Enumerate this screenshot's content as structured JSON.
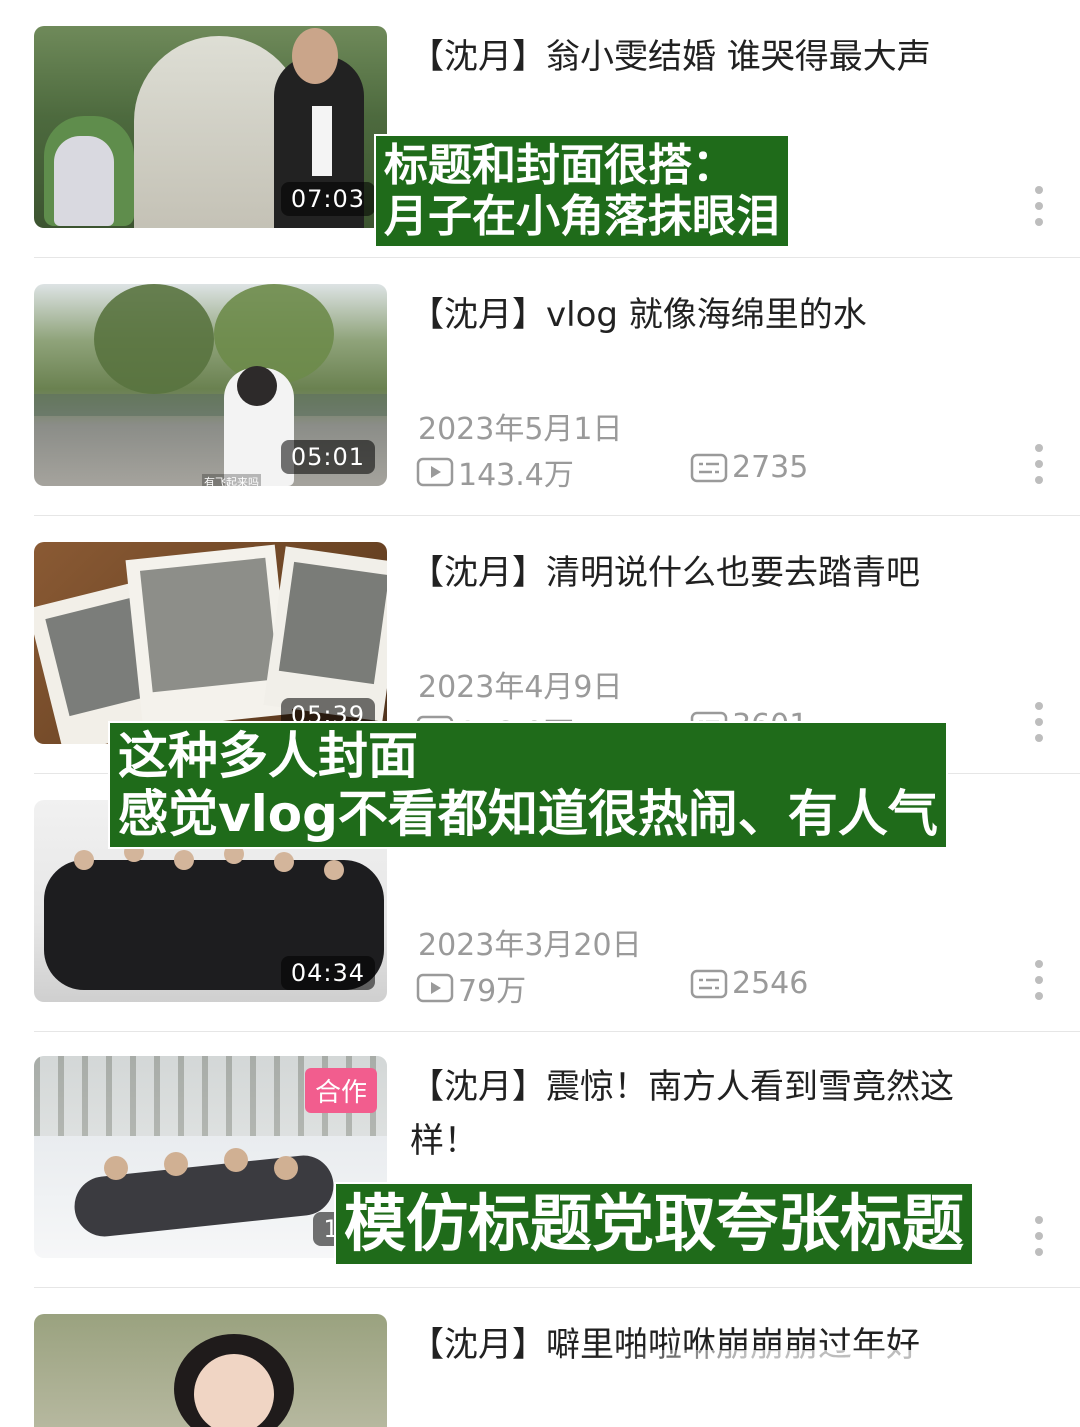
{
  "videos": [
    {
      "title": "【沈月】翁小雯结婚 谁哭得最大声",
      "duration": "07:03",
      "date": "",
      "views": "",
      "comments": "",
      "badge": ""
    },
    {
      "title": "【沈月】vlog 就像海绵里的水",
      "duration": "05:01",
      "date": "2023年5月1日",
      "views": "143.4万",
      "comments": "2735",
      "badge": "",
      "thumb_caption": "有飞起来吗"
    },
    {
      "title": "【沈月】清明说什么也要去踏青吧",
      "duration": "05:39",
      "date": "2023年4月9日",
      "views": "148.0万",
      "comments": "3601",
      "badge": ""
    },
    {
      "title": "",
      "duration": "04:34",
      "date": "2023年3月20日",
      "views": "79万",
      "comments": "2546",
      "badge": ""
    },
    {
      "title": "【沈月】震惊！南方人看到雪竟然这样！",
      "duration": "16:",
      "date": "",
      "views": "",
      "comments": "",
      "badge": "合作"
    },
    {
      "title": "【沈月】噼里啪啦咻崩崩崩过年好",
      "duration": "",
      "date": "",
      "views": "",
      "comments": "",
      "badge": ""
    }
  ],
  "annotations": {
    "note1": "标题和封面很搭：\n月子在小角落抹眼泪",
    "note2": "这种多人封面\n感觉vlog不看都知道很热闹、有人气",
    "note3": "模仿标题党取夸张标题"
  },
  "icons": {
    "views": "play-count-icon",
    "comments": "danmaku-icon",
    "more": "more-vertical-icon"
  },
  "colors": {
    "note_bg": "#1f6b1a",
    "badge": "#f25d8e",
    "meta_text": "#9a9a9a"
  }
}
